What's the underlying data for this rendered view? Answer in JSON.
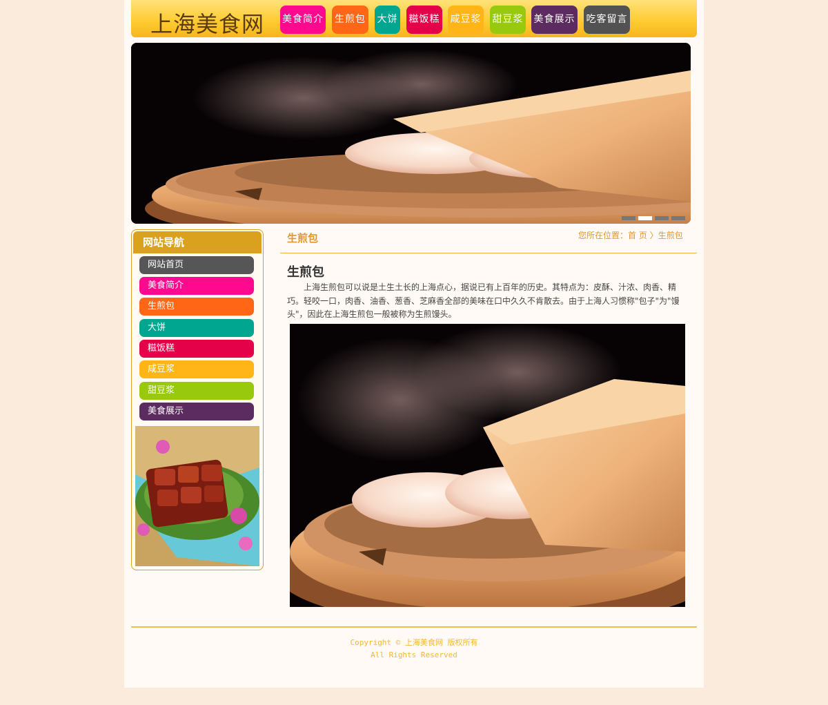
{
  "site": {
    "logo": "上海美食网"
  },
  "topnav": [
    {
      "label": "美食简介",
      "color": "#ff0a8f"
    },
    {
      "label": "生煎包",
      "color": "#ff6716"
    },
    {
      "label": "大饼",
      "color": "#00a690"
    },
    {
      "label": "糍饭糕",
      "color": "#e5004a"
    },
    {
      "label": "咸豆浆",
      "color": "#ffb418"
    },
    {
      "label": "甜豆浆",
      "color": "#98c90c"
    },
    {
      "label": "美食展示",
      "color": "#5c2b5f"
    },
    {
      "label": "吃客留言",
      "color": "#525252"
    }
  ],
  "banner": {
    "image": "steamed-dumplings-bamboo-steamer",
    "slides": 4,
    "active_slide": 2
  },
  "sidebar": {
    "title": "网站导航",
    "items": [
      {
        "label": "网站首页",
        "color": "#565656"
      },
      {
        "label": "美食简介",
        "color": "#ff0a8f"
      },
      {
        "label": "生煎包",
        "color": "#ff6716"
      },
      {
        "label": "大饼",
        "color": "#00a690"
      },
      {
        "label": "糍饭糕",
        "color": "#e5004a"
      },
      {
        "label": "咸豆浆",
        "color": "#ffb418"
      },
      {
        "label": "甜豆浆",
        "color": "#98c90c"
      },
      {
        "label": "美食展示",
        "color": "#5c2b5f"
      }
    ],
    "image": "braised-pork-dish"
  },
  "content": {
    "section_title": "生煎包",
    "breadcrumb": {
      "prefix": "您所在位置：",
      "home": "首 页",
      "separator": "〉",
      "current": "生煎包"
    },
    "article_title": "生煎包",
    "article_text": "上海生煎包可以说是土生土长的上海点心，据说已有上百年的历史。其特点为：皮酥、汁浓、肉香、精巧。轻咬一口，肉香、油香、葱香、芝麻香全部的美味在口中久久不肯散去。由于上海人习惯称\"包子\"为\"馒头\"，因此在上海生煎包一般被称为生煎馒头。",
    "image": "steamed-dumplings-bamboo-steamer"
  },
  "footer": {
    "line1": "Copyright © 上海美食网 版权所有",
    "line2": "All Rights Reserved"
  }
}
